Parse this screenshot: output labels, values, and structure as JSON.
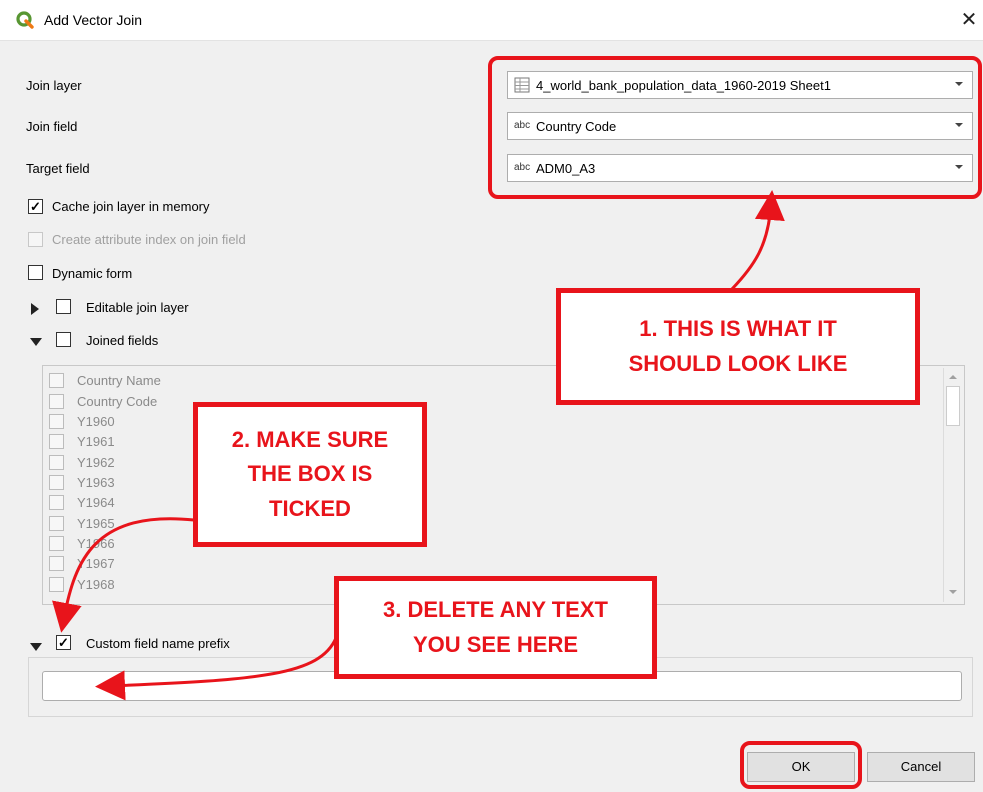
{
  "window": {
    "title": "Add Vector Join",
    "close_glyph": "✕",
    "icon": "qgis-logo-icon"
  },
  "form": {
    "join_layer_label": "Join layer",
    "join_layer_value": "4_world_bank_population_data_1960-2019 Sheet1",
    "join_field_label": "Join field",
    "join_field_value": "Country Code",
    "target_field_label": "Target field",
    "target_field_value": "ADM0_A3",
    "field_type_glyph": "abc"
  },
  "options": {
    "cache_label": "Cache join layer in memory",
    "cache_checked": true,
    "attr_index_label": "Create attribute index on join field",
    "attr_index_checked": false,
    "dynamic_form_label": "Dynamic form",
    "dynamic_form_checked": false,
    "editable_label": "Editable join layer",
    "editable_checked": false,
    "joined_fields_label": "Joined fields",
    "joined_fields_checked": false,
    "custom_prefix_label": "Custom field name prefix",
    "custom_prefix_checked": true,
    "check_glyph": "✓"
  },
  "joined_fields": [
    "Country Name",
    "Country Code",
    "Y1960",
    "Y1961",
    "Y1962",
    "Y1963",
    "Y1964",
    "Y1965",
    "Y1966",
    "Y1967",
    "Y1968"
  ],
  "prefix_input": {
    "value": ""
  },
  "buttons": {
    "ok": "OK",
    "cancel": "Cancel"
  },
  "annotations": {
    "callout1_line1": "1. THIS IS WHAT IT",
    "callout1_line2": "SHOULD LOOK LIKE",
    "callout2_line1": "2. MAKE SURE",
    "callout2_line2": "THE BOX IS",
    "callout2_line3": "TICKED",
    "callout3_line1": "3. DELETE ANY TEXT",
    "callout3_line2": "YOU SEE HERE"
  },
  "colors": {
    "annotation_red": "#e8141b",
    "qgis_green": "#589632"
  }
}
